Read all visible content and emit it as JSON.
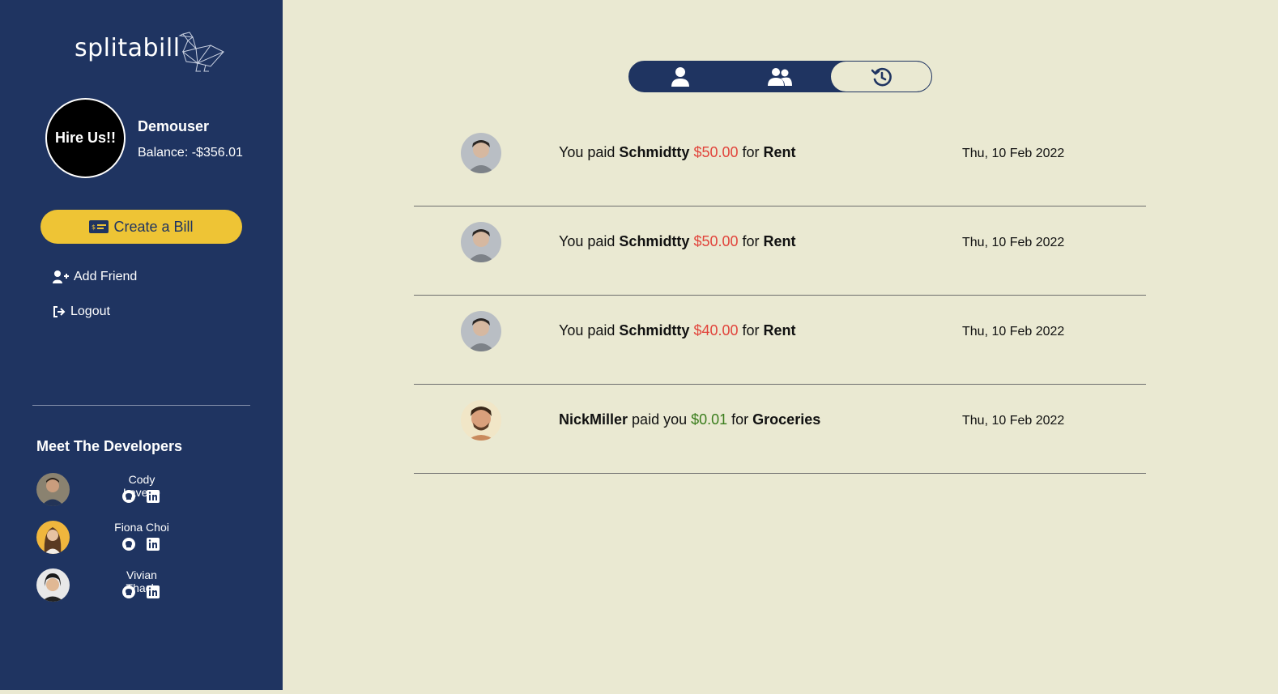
{
  "brand": {
    "name": "splitabill"
  },
  "profile": {
    "badge": "Hire Us!!",
    "username": "Demouser",
    "balance": "Balance: -$356.01"
  },
  "actions": {
    "create_bill": "Create a Bill",
    "add_friend": "Add Friend",
    "logout": "Logout"
  },
  "developers": {
    "title": "Meet The Developers",
    "people": [
      {
        "name": "Cody Lavene"
      },
      {
        "name": "Fiona Choi"
      },
      {
        "name": "Vivian Thach"
      }
    ]
  },
  "tabs": [
    {
      "icon": "user-icon",
      "active": false
    },
    {
      "icon": "users-icon",
      "active": false
    },
    {
      "icon": "history-icon",
      "active": true
    }
  ],
  "transactions": [
    {
      "pre": "You paid ",
      "name": "Schmidtty",
      "amount": "$50.00",
      "amount_type": "debit",
      "mid": " for ",
      "item": "Rent",
      "date": "Thu, 10 Feb 2022"
    },
    {
      "pre": "You paid ",
      "name": "Schmidtty",
      "amount": "$50.00",
      "amount_type": "debit",
      "mid": " for ",
      "item": "Rent",
      "date": "Thu, 10 Feb 2022"
    },
    {
      "pre": "You paid ",
      "name": "Schmidtty",
      "amount": "$40.00",
      "amount_type": "debit",
      "mid": " for ",
      "item": "Rent",
      "date": "Thu, 10 Feb 2022"
    },
    {
      "name": "NickMiller",
      "post": " paid you ",
      "amount": "$0.01",
      "amount_type": "credit",
      "mid": " for ",
      "item": "Groceries",
      "date": "Thu, 10 Feb 2022"
    }
  ],
  "colors": {
    "sidebar": "#1f3461",
    "background": "#eae9d2",
    "accent": "#eec435",
    "debit": "#e1443b",
    "credit": "#3a7d1c"
  }
}
